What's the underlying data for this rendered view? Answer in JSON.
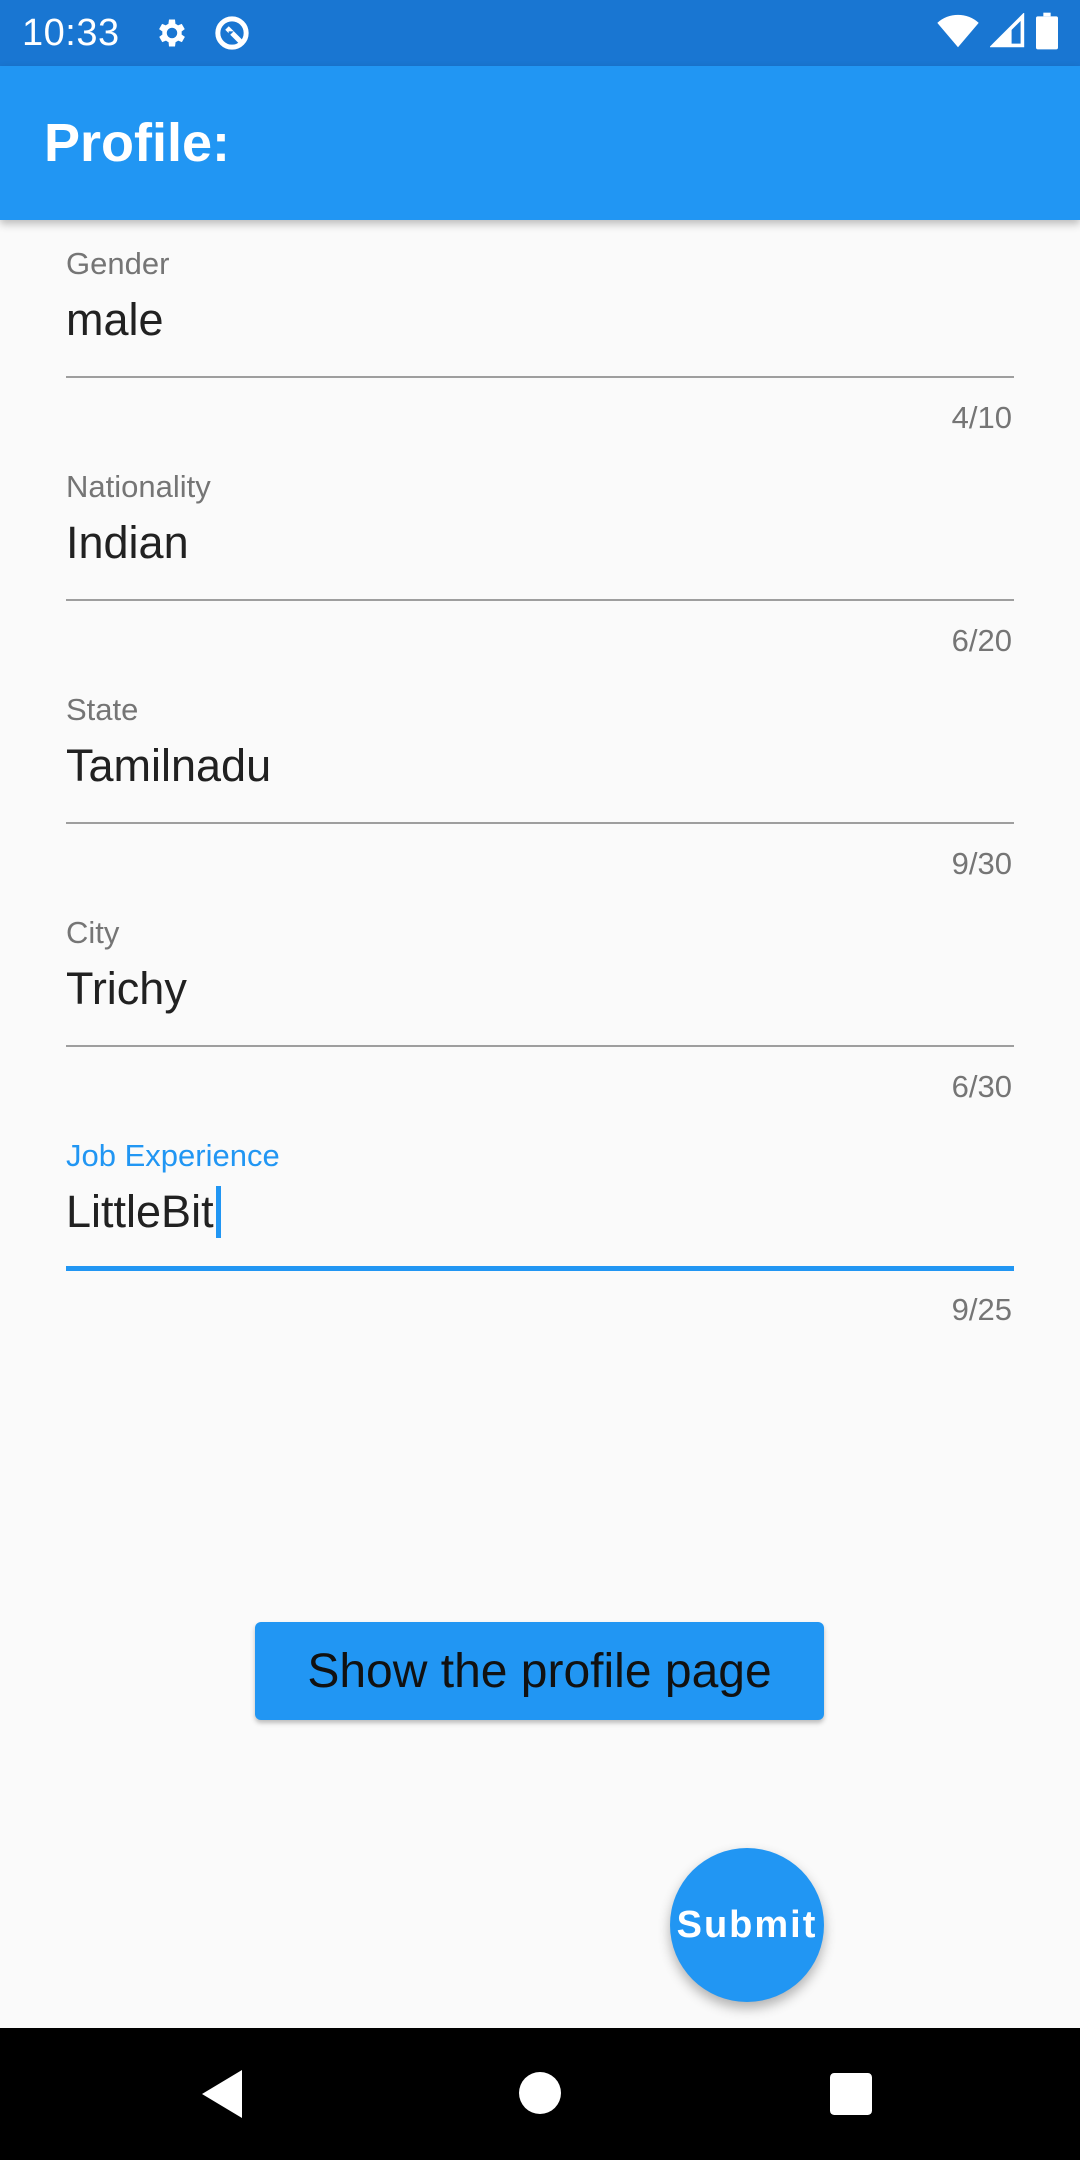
{
  "status_bar": {
    "time": "10:33",
    "icons": [
      "gear-icon",
      "data-saver-icon",
      "wifi-icon",
      "signal-icon",
      "battery-icon"
    ]
  },
  "app_bar": {
    "title": "Profile:"
  },
  "fields": [
    {
      "label": "Gender",
      "value": "male",
      "counter": "4/10"
    },
    {
      "label": "Nationality",
      "value": "Indian",
      "counter": "6/20"
    },
    {
      "label": "State",
      "value": "Tamilnadu",
      "counter": "9/30"
    },
    {
      "label": "City",
      "value": "Trichy",
      "counter": "6/30"
    },
    {
      "label": "Job Experience",
      "value": "LittleBit",
      "counter": "9/25"
    }
  ],
  "profile_button": {
    "label": "Show the profile page"
  },
  "fab": {
    "label": "Submit"
  },
  "nav_bar": {
    "buttons": [
      "back-icon",
      "home-icon",
      "recents-icon"
    ]
  },
  "colors": {
    "primary": "#2196f3",
    "status_bar": "#1976d2",
    "background": "#fafafa"
  }
}
